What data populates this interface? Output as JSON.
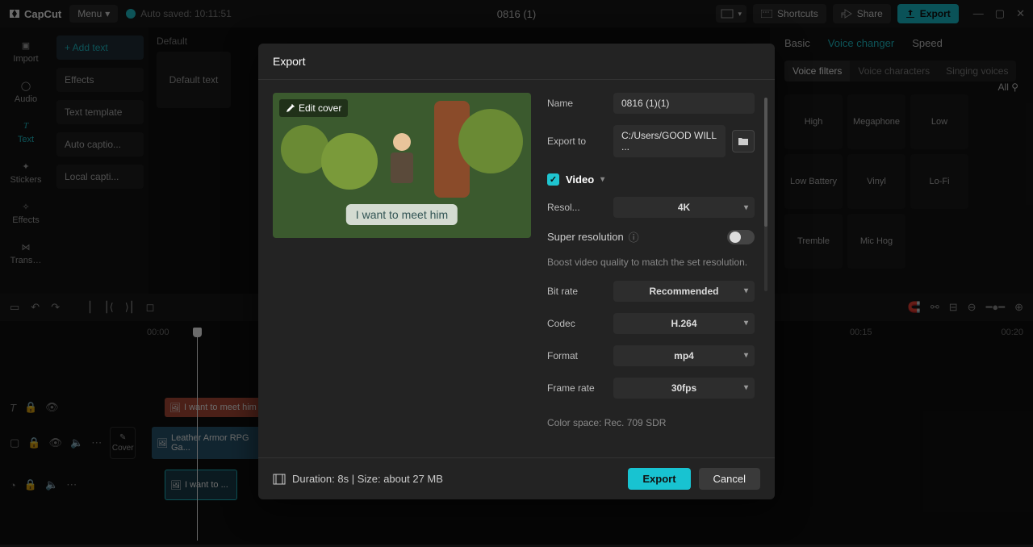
{
  "app": {
    "logo": "CapCut",
    "menu": "Menu",
    "autosave": "Auto saved: 10:11:51",
    "project": "0816 (1)"
  },
  "topbuttons": {
    "shortcuts": "Shortcuts",
    "share": "Share",
    "export": "Export"
  },
  "toolstrip": [
    {
      "id": "import",
      "label": "Import"
    },
    {
      "id": "audio",
      "label": "Audio"
    },
    {
      "id": "text",
      "label": "Text"
    },
    {
      "id": "stickers",
      "label": "Stickers"
    },
    {
      "id": "effects",
      "label": "Effects"
    },
    {
      "id": "transitions",
      "label": "Trans…"
    }
  ],
  "textpanel": {
    "items": [
      {
        "id": "add",
        "label": "+ Add text",
        "active": true
      },
      {
        "id": "effects",
        "label": "Effects"
      },
      {
        "id": "template",
        "label": "Text template"
      },
      {
        "id": "autocap",
        "label": "Auto captio..."
      },
      {
        "id": "localcap",
        "label": "Local capti..."
      }
    ],
    "default_header": "Default",
    "default_card": "Default text"
  },
  "rightpanel": {
    "tabs": [
      "Basic",
      "Voice changer",
      "Speed"
    ],
    "active_tab": "Voice changer",
    "subtabs": [
      "Voice filters",
      "Voice characters",
      "Singing voices"
    ],
    "active_sub": "Voice filters",
    "all": "All",
    "effects_row1": [
      "High",
      "Megaphone",
      "Low",
      "Low Battery"
    ],
    "effects_row2": [
      "Vinyl",
      "Lo-Fi",
      "Tremble",
      "Mic Hog"
    ]
  },
  "timeline": {
    "ticks": [
      "00:00",
      "00:15",
      "00:20"
    ],
    "text_clip": "I want to meet him",
    "video_clip": "Leather Armor RPG Ga...",
    "audio_clip": "I want to ...",
    "cover": "Cover"
  },
  "export": {
    "title": "Export",
    "edit_cover": "Edit cover",
    "subtitle": "I want to meet him",
    "name_label": "Name",
    "name_value": "0816 (1)(1)",
    "path_label": "Export to",
    "path_value": "C:/Users/GOOD WILL ...",
    "video_header": "Video",
    "res_label": "Resol...",
    "res_value": "4K",
    "sr_label": "Super resolution",
    "sr_hint": "Boost video quality to match the set resolution.",
    "bitrate_label": "Bit rate",
    "bitrate_value": "Recommended",
    "codec_label": "Codec",
    "codec_value": "H.264",
    "format_label": "Format",
    "format_value": "mp4",
    "fps_label": "Frame rate",
    "fps_value": "30fps",
    "colorspace": "Color space: Rec. 709 SDR",
    "footer_info": "Duration: 8s | Size: about 27 MB",
    "export_btn": "Export",
    "cancel_btn": "Cancel"
  }
}
